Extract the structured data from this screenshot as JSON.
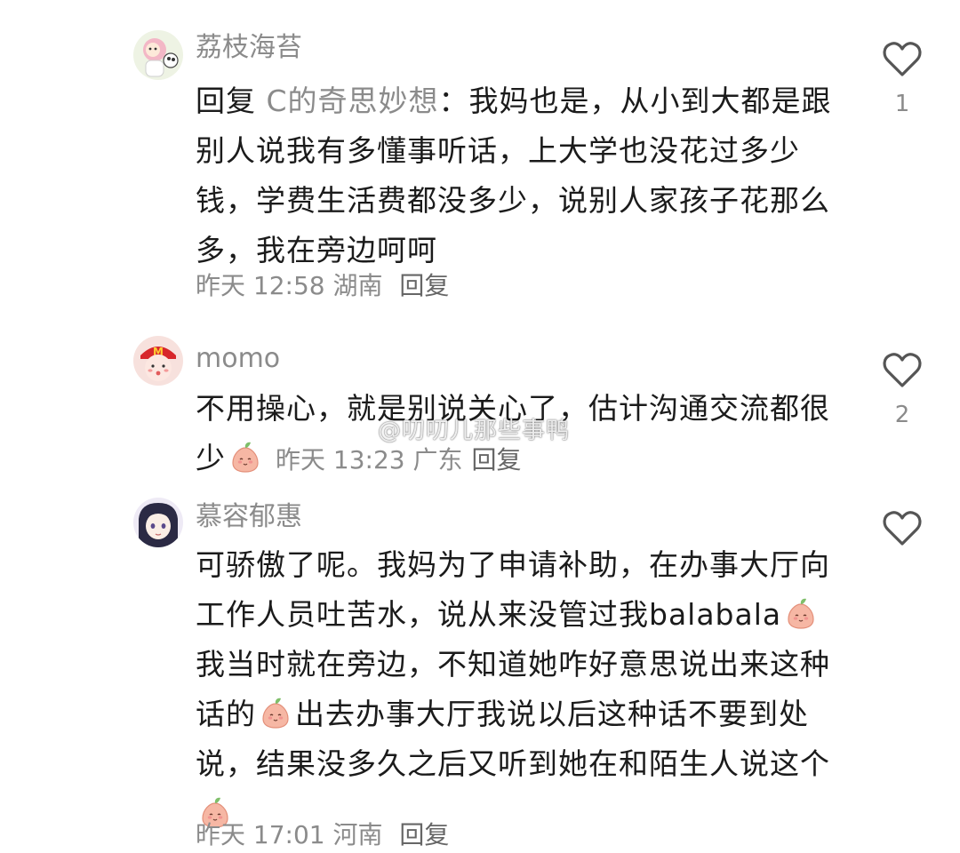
{
  "comments": [
    {
      "username": "荔枝海苔",
      "reply_prefix": "回复",
      "reply_target": "C的奇思妙想",
      "text": "：我妈也是，从小到大都是跟别人说我有多懂事听话，上大学也没花过多少钱，学费生活费都没多少，说别人家孩子花那么多，我在旁边呵呵",
      "time": "昨天 12:58",
      "location": "湖南",
      "reply_label": "回复",
      "likes": "1"
    },
    {
      "username": "momo",
      "text_part1": "不用操心，就是别说关心了，估计沟通交流都很少",
      "time": "昨天 13:23",
      "location": "广东",
      "reply_label": "回复",
      "likes": "2"
    },
    {
      "username": "慕容郁惠",
      "text_part1": "可骄傲了呢。我妈为了申请补助，在办事大厅向工作人员吐苦水，说从来没管过我balabala",
      "text_part2": "我当时就在旁边，不知道她咋好意思说出来这种话的",
      "text_part3": "出去办事大厅我说以后这种话不要到处说，结果没多久之后又听到她在和陌生人说这个",
      "time": "昨天 17:01",
      "location": "河南",
      "reply_label": "回复",
      "likes": ""
    }
  ],
  "watermark": "@叨叨儿那些事鸭",
  "icons": {
    "like": "heart-outline-icon",
    "emoji": "peach-emoji-icon"
  },
  "colors": {
    "username": "#8b8b8b",
    "text": "#1b1b1b",
    "meta": "#8b8b8b",
    "heart_stroke": "#555555"
  }
}
